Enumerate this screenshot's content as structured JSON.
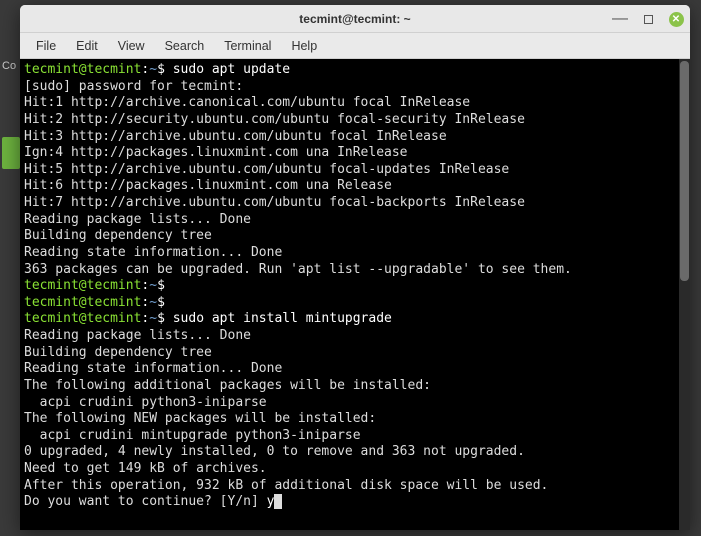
{
  "window": {
    "title": "tecmint@tecmint: ~"
  },
  "menubar": {
    "items": [
      "File",
      "Edit",
      "View",
      "Search",
      "Terminal",
      "Help"
    ]
  },
  "prompt": {
    "userhost": "tecmint@tecmint",
    "sep": ":",
    "path": "~",
    "sym": "$"
  },
  "session": {
    "cmd1": "sudo apt update",
    "cmd2": "sudo apt install mintupgrade",
    "input_y": "y",
    "out": [
      "[sudo] password for tecmint:",
      "Hit:1 http://archive.canonical.com/ubuntu focal InRelease",
      "Hit:2 http://security.ubuntu.com/ubuntu focal-security InRelease",
      "Hit:3 http://archive.ubuntu.com/ubuntu focal InRelease",
      "Ign:4 http://packages.linuxmint.com una InRelease",
      "Hit:5 http://archive.ubuntu.com/ubuntu focal-updates InRelease",
      "Hit:6 http://packages.linuxmint.com una Release",
      "Hit:7 http://archive.ubuntu.com/ubuntu focal-backports InRelease",
      "Reading package lists... Done",
      "Building dependency tree",
      "Reading state information... Done",
      "363 packages can be upgraded. Run 'apt list --upgradable' to see them.",
      "Reading package lists... Done",
      "Building dependency tree",
      "Reading state information... Done",
      "The following additional packages will be installed:",
      "  acpi crudini python3-iniparse",
      "The following NEW packages will be installed:",
      "  acpi crudini mintupgrade python3-iniparse",
      "0 upgraded, 4 newly installed, 0 to remove and 363 not upgraded.",
      "Need to get 149 kB of archives.",
      "After this operation, 932 kB of additional disk space will be used.",
      "Do you want to continue? [Y/n] "
    ]
  },
  "desktop": {
    "partial_text": "Co"
  }
}
